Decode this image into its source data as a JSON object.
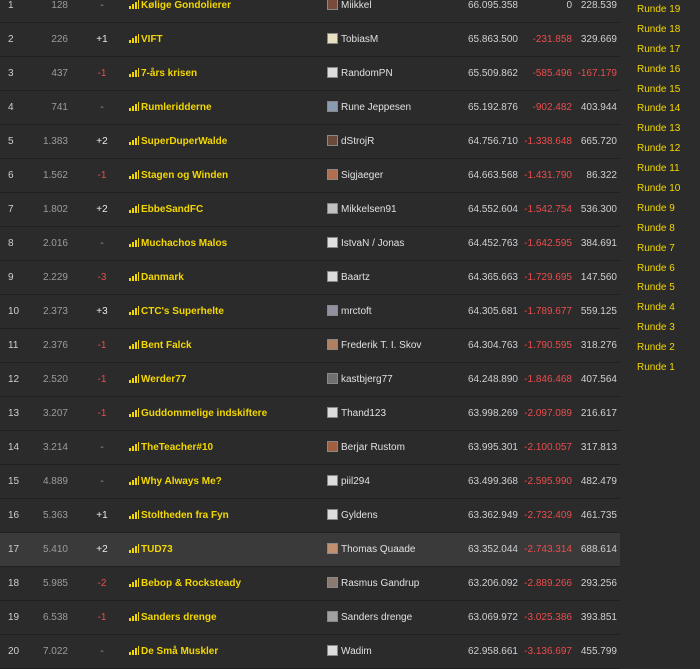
{
  "standings": [
    {
      "rank": "1",
      "gap": "128",
      "change": "-",
      "team": "Kølige Gondolierer",
      "manager": "Miikkel",
      "points": "66.095.358",
      "diff": "0",
      "round": "228.539",
      "avatar": "#7a4a3a"
    },
    {
      "rank": "2",
      "gap": "226",
      "change": "+1",
      "team": "VIFT",
      "manager": "TobiasM",
      "points": "65.863.500",
      "diff": "-231.858",
      "round": "329.669",
      "avatar": "#e8e0c0"
    },
    {
      "rank": "3",
      "gap": "437",
      "change": "-1",
      "team": "7-års krisen",
      "manager": "RandomPN",
      "points": "65.509.862",
      "diff": "-585.496",
      "round": "-167.179",
      "avatar": "#dcdcdc"
    },
    {
      "rank": "4",
      "gap": "741",
      "change": "-",
      "team": "Rumleridderne",
      "manager": "Rune Jeppesen",
      "points": "65.192.876",
      "diff": "-902.482",
      "round": "403.944",
      "avatar": "#8a9ab0"
    },
    {
      "rank": "5",
      "gap": "1.383",
      "change": "+2",
      "team": "SuperDuperWalde",
      "manager": "dStrojR",
      "points": "64.756.710",
      "diff": "-1.338.648",
      "round": "665.720",
      "avatar": "#6a4a3a"
    },
    {
      "rank": "6",
      "gap": "1.562",
      "change": "-1",
      "team": "Stagen og Winden",
      "manager": "Sigjaeger",
      "points": "64.663.568",
      "diff": "-1.431.790",
      "round": "86.322",
      "avatar": "#b07050"
    },
    {
      "rank": "7",
      "gap": "1.802",
      "change": "+2",
      "team": "EbbeSandFC",
      "manager": "Mikkelsen91",
      "points": "64.552.604",
      "diff": "-1.542.754",
      "round": "536.300",
      "avatar": "#c0c0c0"
    },
    {
      "rank": "8",
      "gap": "2.016",
      "change": "-",
      "team": "Muchachos Malos",
      "manager": "IstvaN / Jonas",
      "points": "64.452.763",
      "diff": "-1.642.595",
      "round": "384.691",
      "avatar": "#e0e0e0"
    },
    {
      "rank": "9",
      "gap": "2.229",
      "change": "-3",
      "team": "Danmark",
      "manager": "Baartz",
      "points": "64.365.663",
      "diff": "-1.729.695",
      "round": "147.560",
      "avatar": "#dcdcdc"
    },
    {
      "rank": "10",
      "gap": "2.373",
      "change": "+3",
      "team": "CTC's Superhelte",
      "manager": "mrctoft",
      "points": "64.305.681",
      "diff": "-1.789.677",
      "round": "559.125",
      "avatar": "#9090a0"
    },
    {
      "rank": "11",
      "gap": "2.376",
      "change": "-1",
      "team": "Bent Falck",
      "manager": "Frederik T. I. Skov",
      "points": "64.304.763",
      "diff": "-1.790.595",
      "round": "318.276",
      "avatar": "#b08060"
    },
    {
      "rank": "12",
      "gap": "2.520",
      "change": "-1",
      "team": "Werder77",
      "manager": "kastbjerg77",
      "points": "64.248.890",
      "diff": "-1.846.468",
      "round": "407.564",
      "avatar": "#707070"
    },
    {
      "rank": "13",
      "gap": "3.207",
      "change": "-1",
      "team": "Guddommelige indskiftere",
      "manager": "Thand123",
      "points": "63.998.269",
      "diff": "-2.097.089",
      "round": "216.617",
      "avatar": "#dcdcdc"
    },
    {
      "rank": "14",
      "gap": "3.214",
      "change": "-",
      "team": "TheTeacher#10",
      "manager": "Berjar Rustom",
      "points": "63.995.301",
      "diff": "-2.100.057",
      "round": "317.813",
      "avatar": "#a06040"
    },
    {
      "rank": "15",
      "gap": "4.889",
      "change": "-",
      "team": "Why Always Me?",
      "manager": "piil294",
      "points": "63.499.368",
      "diff": "-2.595.990",
      "round": "482.479",
      "avatar": "#dcdcdc"
    },
    {
      "rank": "16",
      "gap": "5.363",
      "change": "+1",
      "team": "Stoltheden fra Fyn",
      "manager": "Gyldens",
      "points": "63.362.949",
      "diff": "-2.732.409",
      "round": "461.735",
      "avatar": "#dcdcdc"
    },
    {
      "rank": "17",
      "gap": "5.410",
      "change": "+2",
      "team": "TUD73",
      "manager": "Thomas Quaade",
      "points": "63.352.044",
      "diff": "-2.743.314",
      "round": "688.614",
      "avatar": "#c09070",
      "highlight": true
    },
    {
      "rank": "18",
      "gap": "5.985",
      "change": "-2",
      "team": "Bebop & Rocksteady",
      "manager": "Rasmus Gandrup",
      "points": "63.206.092",
      "diff": "-2.889.266",
      "round": "293.256",
      "avatar": "#8a7a70"
    },
    {
      "rank": "19",
      "gap": "6.538",
      "change": "-1",
      "team": "Sanders drenge",
      "manager": "Sanders drenge",
      "points": "63.069.972",
      "diff": "-3.025.386",
      "round": "393.851",
      "avatar": "#a0a0a0"
    },
    {
      "rank": "20",
      "gap": "7.022",
      "change": "-",
      "team": "De Små Muskler",
      "manager": "Wadim",
      "points": "62.958.661",
      "diff": "-3.136.697",
      "round": "455.799",
      "avatar": "#dcdcdc"
    }
  ],
  "rounds": [
    "Runde 19",
    "Runde 18",
    "Runde 17",
    "Runde 16",
    "Runde 15",
    "Runde 14",
    "Runde 13",
    "Runde 12",
    "Runde 11",
    "Runde 10",
    "Runde 9",
    "Runde 8",
    "Runde 7",
    "Runde 6",
    "Runde 5",
    "Runde 4",
    "Runde 3",
    "Runde 2",
    "Runde 1"
  ],
  "colors": {
    "accent": "#f3d700",
    "negative": "#ea4d4d",
    "background": "#2b2b2b",
    "highlight_row": "#3a3a3a"
  }
}
